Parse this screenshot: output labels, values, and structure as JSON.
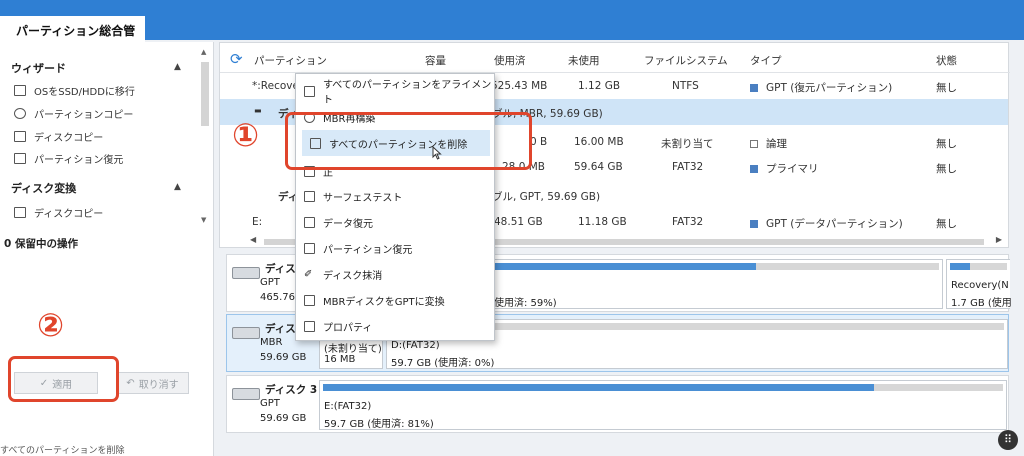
{
  "app": {
    "tab_title": "パーティション総合管理"
  },
  "sidebar": {
    "wizard_title": "ウィザード",
    "wizard_items": [
      "OSをSSD/HDDに移行",
      "パーティションコピー",
      "ディスクコピー",
      "パーティション復元"
    ],
    "disk_convert_title": "ディスク変換",
    "disk_convert_items": [
      "ディスクコピー"
    ],
    "pending_ops": "0 保留中の操作",
    "apply_label": "適用",
    "undo_label": "取り消す",
    "status_text": "すべてのパーティションを削除"
  },
  "table": {
    "headers": [
      "パーティション",
      "容量",
      "使用済",
      "未使用",
      "ファイルシステム",
      "タイプ",
      "状態"
    ],
    "rows": [
      {
        "partition": "*:Recove",
        "used": "525.43 MB",
        "unused": "1.12 GB",
        "fs": "NTFS",
        "type": "GPT (復元パーティション)",
        "type_color": "#4a7fc1",
        "status": "無し"
      },
      {
        "partition": "ディ",
        "disk_summary": "ブル, MBR, 59.69 GB)"
      },
      {
        "partition": "",
        "used": "0 B",
        "unused": "16.00 MB",
        "fs": "未割り当て",
        "type": "論理",
        "type_color": "#b8b8b8",
        "status": "無し"
      },
      {
        "partition": "",
        "used": "28.0 MB",
        "unused": "59.64 GB",
        "fs": "FAT32",
        "type": "プライマリ",
        "type_color": "#4a7fc1",
        "status": "無し"
      },
      {
        "partition": "ディ",
        "disk_summary": "ブル, GPT, 59.69 GB)"
      },
      {
        "partition": "E:",
        "used": "48.51 GB",
        "unused": "11.18 GB",
        "fs": "FAT32",
        "type": "GPT (データパーティション)",
        "type_color": "#4a7fc1",
        "status": "無し"
      }
    ]
  },
  "disks": [
    {
      "name": "ディスク",
      "type": "GPT",
      "size": "465.76",
      "usage_text": "使用済: 59%)",
      "usage_fraction": 0.59,
      "extra_label": "Recovery(N",
      "extra_size": "1.7 GB (使用"
    },
    {
      "name": "ディスク",
      "type": "MBR",
      "size": "59.69 GB",
      "unalloc_label": "(未割り当て)",
      "unalloc_size": "16 MB",
      "part_label": "D:(FAT32)",
      "part_usage": "59.7 GB (使用済: 0%)",
      "usage_fraction": 0.0
    },
    {
      "name": "ディスク 3",
      "type": "GPT",
      "size": "59.69 GB",
      "part_label": "E:(FAT32)",
      "part_usage": "59.7 GB (使用済: 81%)",
      "usage_fraction": 0.81
    }
  ],
  "context_menu": {
    "items": [
      "すべてのパーティションをアライメント",
      "MBR再構築",
      "すべてのパーティションを削除",
      "正",
      "サーフェステスト",
      "データ復元",
      "パーティション復元",
      "ディスク抹消",
      "MBRディスクをGPTに変換",
      "プロパティ"
    ],
    "highlighted_index": 2
  },
  "annotations": {
    "step1": "①",
    "step2": "②"
  },
  "colors": {
    "accent": "#2f7fd3",
    "highlight_red": "#e0452c",
    "bar_fill": "#4a8fd4"
  }
}
